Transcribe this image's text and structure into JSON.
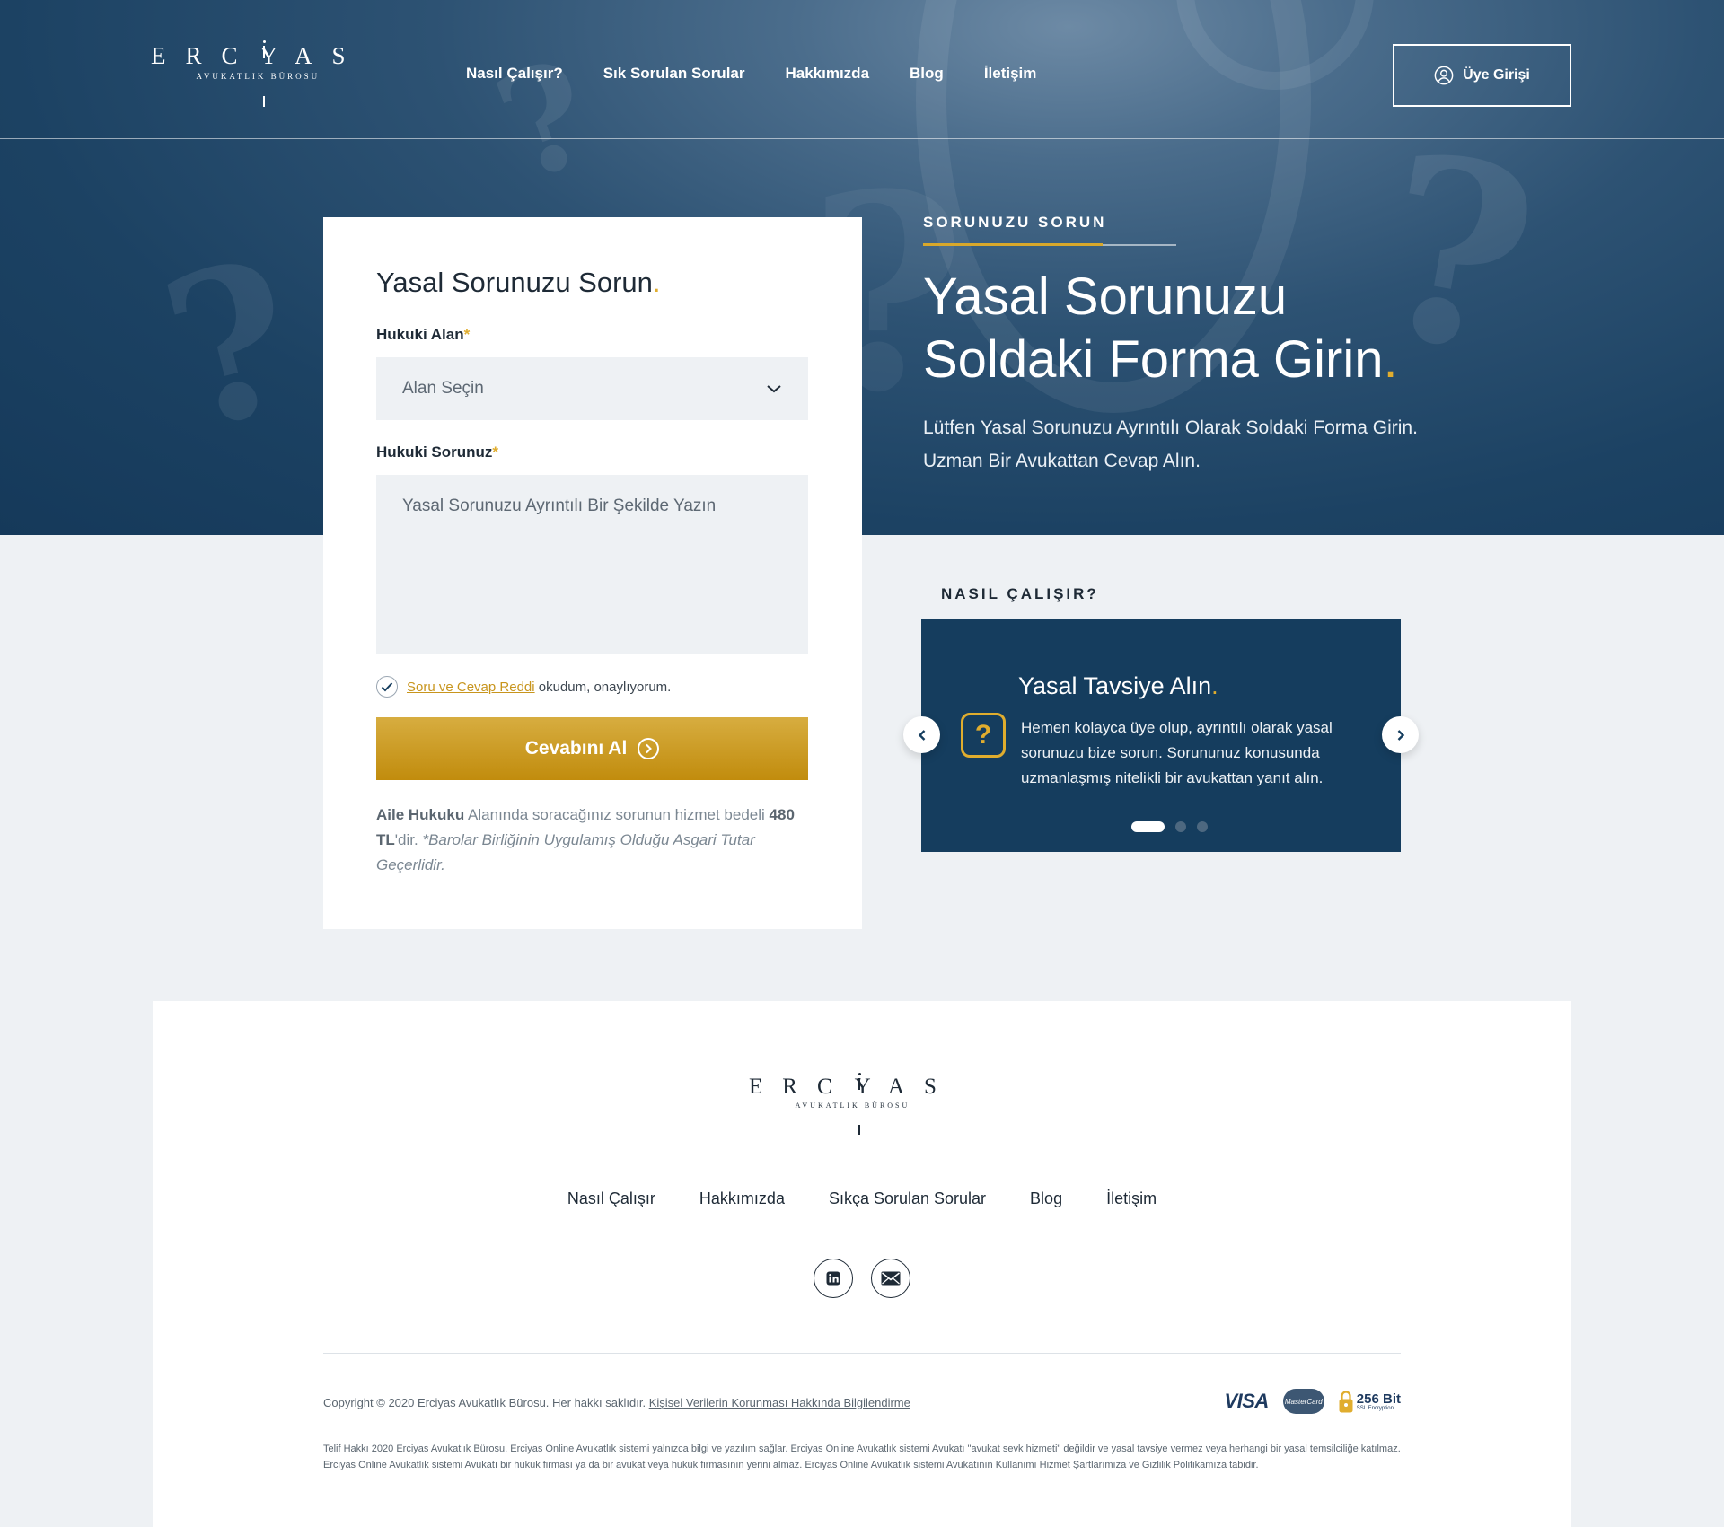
{
  "brand": {
    "name_letters": [
      "E",
      "R",
      "C",
      "I",
      "Y",
      "A",
      "S"
    ],
    "subtitle": "AVUKATLIK BÜROSU"
  },
  "nav": {
    "items": [
      "Nasıl Çalışır?",
      "Sık Sorulan Sorular",
      "Hakkımızda",
      "Blog",
      "İletişim"
    ]
  },
  "login": {
    "label": "Üye Girişi",
    "icon": "user-circle-icon"
  },
  "hero": {
    "eyebrow": "SORUNUZU SORUN",
    "title_line1": "Yasal Sorunuzu",
    "title_line2": "Soldaki Forma Girin",
    "title_dot": ".",
    "description": "Lütfen Yasal Sorunuzu Ayrıntılı Olarak Soldaki Forma Girin. Uzman Bir Avukattan Cevap Alın."
  },
  "form": {
    "title": "Yasal Sorunuzu Sorun",
    "title_dot": ".",
    "area_label": "Hukuki Alan",
    "area_required": "*",
    "area_value": "Alan Seçin",
    "question_label": "Hukuki Sorunuz",
    "question_required": "*",
    "question_placeholder": "Yasal Sorunuzu Ayrıntılı Bir Şekilde Yazın",
    "consent_link": "Soru ve Cevap Reddi",
    "consent_text": "okudum, onaylıyorum.",
    "consent_checked": true,
    "submit_label": "Cevabını Al",
    "note_area": "Aile Hukuku",
    "note_text1": "Alanında soracağınız sorunun hizmet bedeli",
    "note_price": "480 TL",
    "note_text2": "'dir.",
    "note_italic": "*Barolar Birliğinin Uygulamış Olduğu Asgari Tutar Geçerlidir."
  },
  "how": {
    "label": "NASIL ÇALIŞIR?",
    "slide_title": "Yasal Tavsiye Alın",
    "slide_dot": ".",
    "slide_icon": "question-icon",
    "slide_text": "Hemen kolayca üye olup, ayrıntılı olarak yasal sorunuzu bize sorun. Sorununuz konusunda uzmanlaşmış nitelikli bir avukattan yanıt alın.",
    "active_slide": 1,
    "slide_count": 3
  },
  "footer": {
    "nav": [
      "Nasıl Çalışır",
      "Hakkımızda",
      "Sıkça Sorulan Sorular",
      "Blog",
      "İletişim"
    ],
    "social": [
      "linkedin-icon",
      "mail-icon"
    ],
    "copyright": "Copyright © 2020 Erciyas Avukatlık Bürosu. Her hakkı saklıdır.",
    "privacy_link": "Kişisel Verilerin Korunması Hakkında Bilgilendirme",
    "payments": {
      "visa": "VISA",
      "mastercard": "MasterCard",
      "ssl_big": "256 Bit",
      "ssl_small": "SSL Encryption"
    },
    "legal": "Telif Hakkı 2020 Erciyas Avukatlık Bürosu. Erciyas Online Avukatlık sistemi yalnızca bilgi ve yazılım sağlar. Erciyas Online Avukatlık sistemi Avukatı \"avukat sevk hizmeti\" değildir ve yasal tavsiye vermez veya herhangi bir yasal temsilciliğe katılmaz. Erciyas Online Avukatlık sistemi Avukatı bir hukuk firması ya da bir avukat veya hukuk firmasının yerini almaz. Erciyas Online Avukatlık sistemi Avukatının Kullanımı Hizmet Şartlarımıza ve Gizlilik Politikamıza tabidir."
  },
  "colors": {
    "accent": "#e0ad2e",
    "navy": "#153d5e",
    "page_bg": "#eef1f4"
  }
}
